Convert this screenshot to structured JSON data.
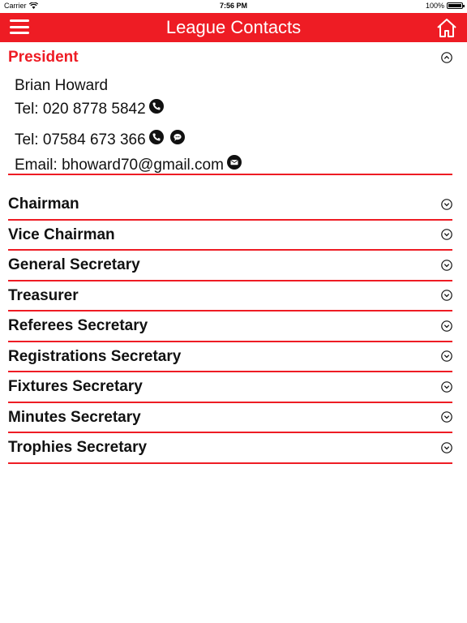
{
  "status": {
    "carrier": "Carrier",
    "time": "7:56 PM",
    "battery": "100%"
  },
  "nav": {
    "title": "League Contacts"
  },
  "president": {
    "title": "President",
    "name": "Brian Howard",
    "tel1": "Tel: 020 8778 5842",
    "tel2": "Tel: 07584 673 366",
    "email": "Email: bhoward70@gmail.com"
  },
  "sections": [
    {
      "title": "Chairman"
    },
    {
      "title": "Vice Chairman"
    },
    {
      "title": "General Secretary"
    },
    {
      "title": "Treasurer"
    },
    {
      "title": "Referees Secretary"
    },
    {
      "title": "Registrations Secretary"
    },
    {
      "title": "Fixtures Secretary"
    },
    {
      "title": "Minutes Secretary"
    },
    {
      "title": "Trophies Secretary"
    }
  ],
  "colors": {
    "accent": "#ee1c24",
    "text": "#111111",
    "background": "#ffffff"
  }
}
